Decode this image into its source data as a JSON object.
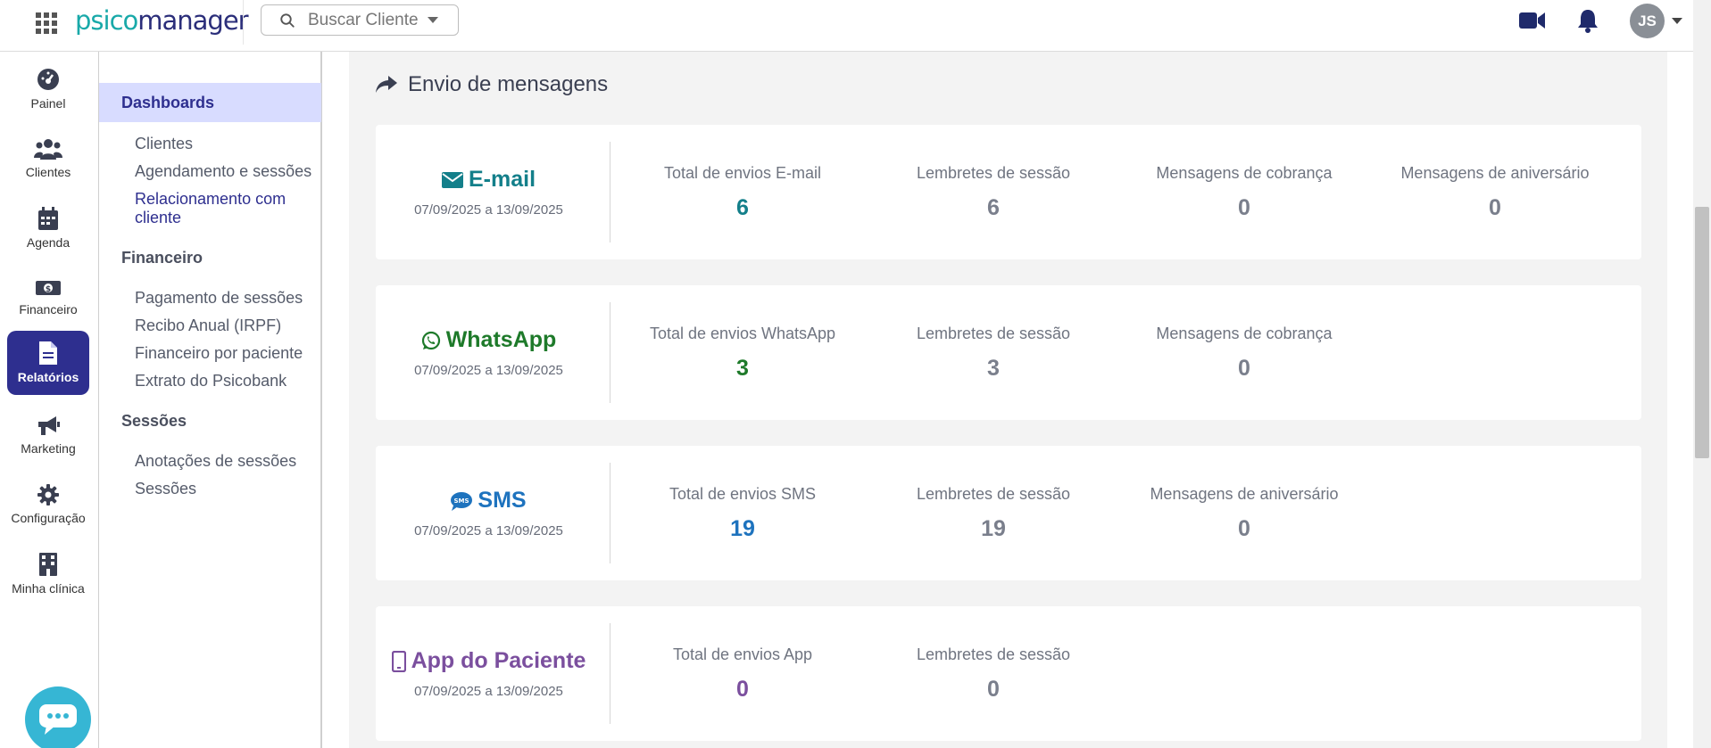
{
  "app": {
    "logo_part1": "psico",
    "logo_part2": "manager",
    "search_placeholder": "Buscar Cliente",
    "user_initials": "JS"
  },
  "rail": {
    "items": [
      {
        "label": "Painel",
        "icon": "dashboard-icon"
      },
      {
        "label": "Clientes",
        "icon": "users-icon"
      },
      {
        "label": "Agenda",
        "icon": "calendar-icon"
      },
      {
        "label": "Financeiro",
        "icon": "money-icon"
      },
      {
        "label": "Relatórios",
        "icon": "report-icon",
        "active": true
      },
      {
        "label": "Marketing",
        "icon": "megaphone-icon"
      },
      {
        "label": "Configuração",
        "icon": "gear-icon"
      },
      {
        "label": "Minha clínica",
        "icon": "building-icon"
      }
    ]
  },
  "submenu": {
    "active": "Dashboards",
    "dashboards_links": [
      "Clientes",
      "Agendamento e sessões",
      "Relacionamento com cliente"
    ],
    "financeiro_head": "Financeiro",
    "financeiro_links": [
      "Pagamento de sessões",
      "Recibo Anual (IRPF)",
      "Financeiro por paciente",
      "Extrato do Psicobank"
    ],
    "sessoes_head": "Sessões",
    "sessoes_links": [
      "Anotações de sessões",
      "Sessões"
    ]
  },
  "main": {
    "section_title": "Envio de mensagens",
    "cards": [
      {
        "name": "E-mail",
        "date": "07/09/2025 a 13/09/2025",
        "color": "#137f8a",
        "icon": "envelope-icon",
        "stats": [
          {
            "label": "Total de envios E-mail",
            "value": "6"
          },
          {
            "label": "Lembretes de sessão",
            "value": "6"
          },
          {
            "label": "Mensagens de cobrança",
            "value": "0"
          },
          {
            "label": "Mensagens de aniversário",
            "value": "0"
          }
        ]
      },
      {
        "name": "WhatsApp",
        "date": "07/09/2025 a 13/09/2025",
        "color": "#1e7a2a",
        "icon": "whatsapp-icon",
        "stats": [
          {
            "label": "Total de envios WhatsApp",
            "value": "3"
          },
          {
            "label": "Lembretes de sessão",
            "value": "3"
          },
          {
            "label": "Mensagens de cobrança",
            "value": "0"
          }
        ]
      },
      {
        "name": "SMS",
        "date": "07/09/2025 a 13/09/2025",
        "color": "#1e73be",
        "icon": "sms-icon",
        "stats": [
          {
            "label": "Total de envios SMS",
            "value": "19"
          },
          {
            "label": "Lembretes de sessão",
            "value": "19"
          },
          {
            "label": "Mensagens de aniversário",
            "value": "0"
          }
        ]
      },
      {
        "name": "App do Paciente",
        "date": "07/09/2025 a 13/09/2025",
        "color": "#7b4f9e",
        "icon": "mobile-icon",
        "stats": [
          {
            "label": "Total de envios App",
            "value": "0"
          },
          {
            "label": "Lembretes de sessão",
            "value": "0"
          }
        ]
      }
    ]
  }
}
